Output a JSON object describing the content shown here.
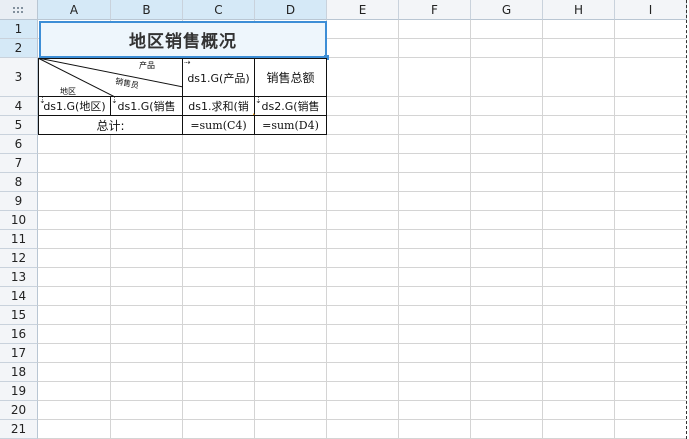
{
  "columns": [
    "A",
    "B",
    "C",
    "D",
    "E",
    "F",
    "G",
    "H",
    "I"
  ],
  "rows": [
    "1",
    "2",
    "3",
    "4",
    "5",
    "6",
    "7",
    "8",
    "9",
    "10",
    "11",
    "12",
    "13",
    "14",
    "15",
    "16",
    "17",
    "18",
    "19",
    "20",
    "21"
  ],
  "report": {
    "title": "地区销售概况",
    "header": {
      "diag_top": "产品",
      "diag_mid": "销售员",
      "diag_bottom": "地区",
      "c3": "ds1.G(产品)",
      "d3": "销售总额"
    },
    "row4": {
      "a4": "ds1.G(地区)",
      "b4": "ds1.G(销售",
      "c4": "ds1.求和(销",
      "d4": "ds2.G(销售"
    },
    "row5": {
      "total_label": "总计:",
      "c5": "=sum(C4)",
      "d5": "=sum(D4)"
    }
  },
  "colors": {
    "selection": "#3d8ed6",
    "header_selected": "#d5e9f7",
    "grid": "#d4d4d4"
  },
  "icons": {
    "corner": "select-all-grid-icon",
    "expand_down": "expand-down-marker-icon",
    "expand_right": "expand-right-marker-icon"
  }
}
